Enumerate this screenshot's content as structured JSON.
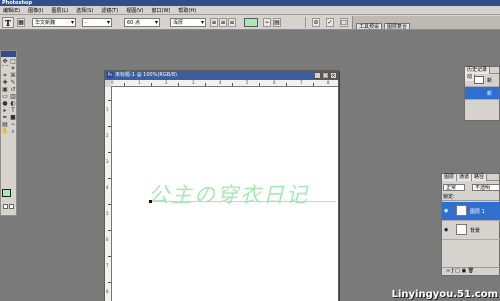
{
  "app": {
    "title": "Photoshop"
  },
  "menu": [
    "编辑(E)",
    "图像(I)",
    "图层(L)",
    "选择(S)",
    "滤镜(T)",
    "视图(V)",
    "窗口(W)",
    "帮助(H)"
  ],
  "options": {
    "tool_icon": "T",
    "font_family": "华文新魏",
    "font_style": "-",
    "font_size": "60 点",
    "antialias": "浑厚",
    "dock_tabs": [
      "工具预设",
      "图层复合"
    ]
  },
  "document": {
    "title": "未标题-1 @ 100%(RGB/8)",
    "ruler_h": [
      "0",
      "1",
      "2",
      "3",
      "4",
      "5",
      "6",
      "7",
      "8"
    ],
    "ruler_v": [
      "1",
      "2",
      "3",
      "4",
      "5",
      "6",
      "7",
      "8"
    ],
    "text": "公主の穿衣日记"
  },
  "history": {
    "tabs": [
      "历史记录",
      "动"
    ],
    "items": [
      "新",
      "新"
    ]
  },
  "layers": {
    "tabs": [
      "图层",
      "通道",
      "路径"
    ],
    "blend": "正常",
    "opacity": "不透明",
    "lock_label": "锁定:",
    "items": [
      {
        "name": "图层 1",
        "thumb": "T"
      },
      {
        "name": "背景",
        "thumb": ""
      }
    ]
  },
  "watermark": "Linyingyou.51.com"
}
